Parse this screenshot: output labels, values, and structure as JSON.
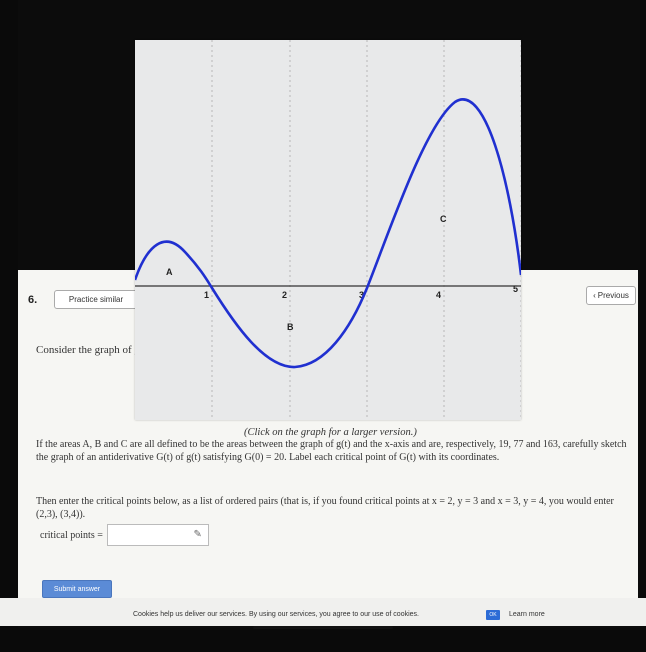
{
  "question": {
    "number": "6.",
    "practice_label": "Practice similar",
    "previous_label": "Previous",
    "consider_text": "Consider the graph of g",
    "caption": "(Click on the graph for a larger version.)",
    "paragraph1": "If the areas A, B and C are all defined to be the areas between the graph of g(t) and the x-axis and are, respectively, 19, 77 and 163, carefully sketch the graph of an antiderivative G(t) of g(t) satisfying G(0) = 20. Label each critical point of G(t) with its coordinates.",
    "paragraph2": "Then enter the critical points below, as a list of ordered pairs (that is, if you found critical points at x = 2, y = 3 and x = 3, y = 4, you would enter (2,3), (3,4)).",
    "answer_label": "critical points =",
    "answer_value": "",
    "submit_label": "Submit answer"
  },
  "graph": {
    "x_ticks": [
      "1",
      "2",
      "3",
      "4",
      "5"
    ],
    "region_labels": [
      "A",
      "B",
      "C"
    ],
    "curve_color": "#2030d0"
  },
  "cookie": {
    "text": "Cookies help us deliver our services. By using our services, you agree to our use of cookies.",
    "ok_label": "OK",
    "learn_more": "Learn more"
  }
}
